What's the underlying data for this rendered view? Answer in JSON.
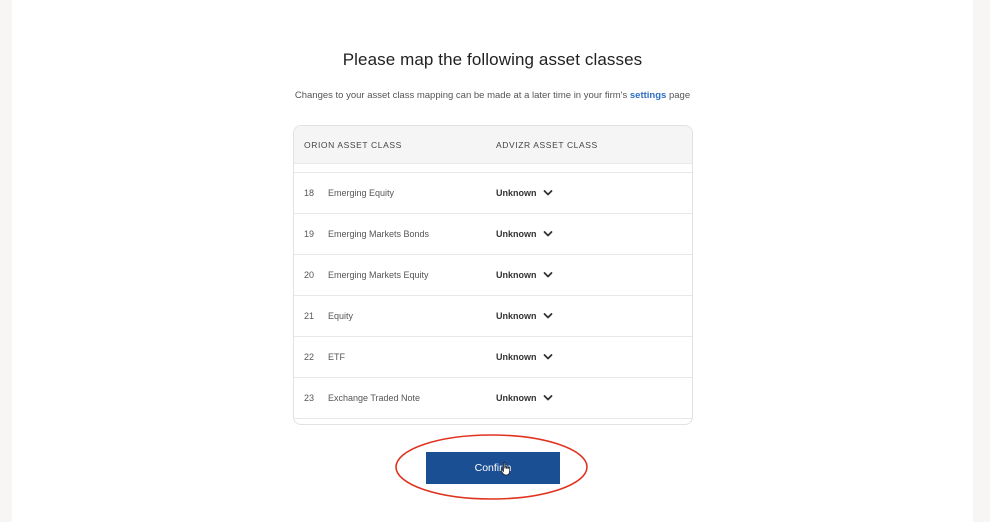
{
  "header": {
    "title": "Please map the following asset classes",
    "subtitle_prefix": "Changes to your asset class mapping can be made at a later time in your firm's",
    "subtitle_link": "settings",
    "subtitle_suffix": "page"
  },
  "table": {
    "columns": [
      "ORION ASSET CLASS",
      "ADVIZR ASSET CLASS"
    ],
    "rows": [
      {
        "num": "18",
        "name": "Emerging Equity",
        "value": "Unknown"
      },
      {
        "num": "19",
        "name": "Emerging Markets Bonds",
        "value": "Unknown"
      },
      {
        "num": "20",
        "name": "Emerging Markets Equity",
        "value": "Unknown"
      },
      {
        "num": "21",
        "name": "Equity",
        "value": "Unknown"
      },
      {
        "num": "22",
        "name": "ETF",
        "value": "Unknown"
      },
      {
        "num": "23",
        "name": "Exchange Traded Note",
        "value": "Unknown"
      }
    ]
  },
  "confirm_label": "Confirm",
  "colors": {
    "primary": "#1a4f94",
    "link": "#2f6fc4",
    "annotation": "#e0331f"
  },
  "icons": {
    "dropdown": "chevron-down-icon",
    "cursor": "hand-cursor-icon"
  }
}
